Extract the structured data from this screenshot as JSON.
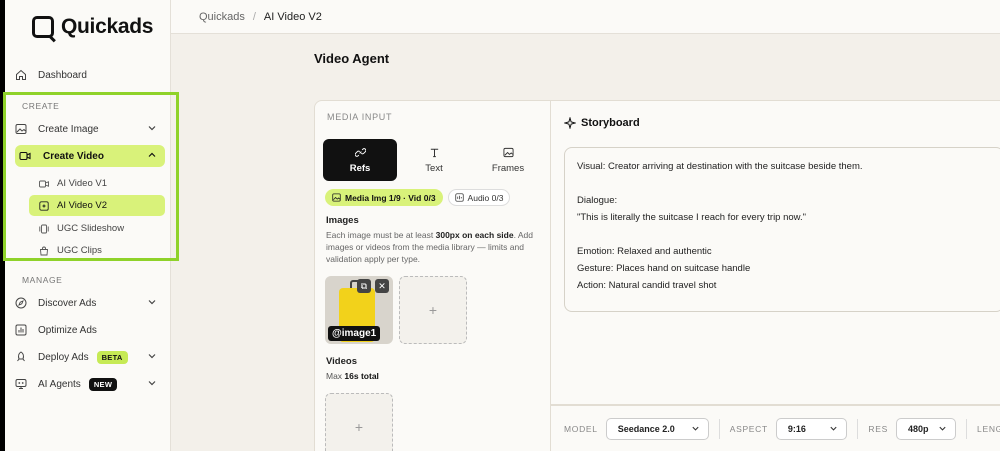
{
  "app": {
    "name": "Quickads"
  },
  "breadcrumb": {
    "root": "Quickads",
    "separator": "/",
    "current": "AI Video V2"
  },
  "sidebar": {
    "dashboard": "Dashboard",
    "create_section": "CREATE",
    "create_image": "Create Image",
    "create_video": "Create Video",
    "video_items": [
      "AI Video V1",
      "AI Video V2",
      "UGC Slideshow",
      "UGC Clips"
    ],
    "manage_section": "MANAGE",
    "discover_ads": "Discover Ads",
    "optimize_ads": "Optimize Ads",
    "deploy_ads": "Deploy Ads",
    "deploy_badge": "BETA",
    "ai_agents": "AI Agents",
    "agents_badge": "NEW"
  },
  "page": {
    "title": "Video Agent"
  },
  "media_input": {
    "label": "MEDIA INPUT",
    "tabs": [
      "Refs",
      "Text",
      "Frames"
    ],
    "active_tab": "Refs",
    "chips": {
      "media": "Media Img 1/9 · Vid 0/3",
      "audio": "Audio 0/3"
    },
    "images_heading": "Images",
    "help_pre": "Each image must be at least ",
    "help_bold": "300px on each side",
    "help_post": ". Add images or videos from the media library — limits and validation apply per type.",
    "image_tag": "@image1",
    "videos_heading": "Videos",
    "videos_max_pre": "Max ",
    "videos_max_bold": "16s total",
    "add_symbol": "+"
  },
  "storyboard": {
    "title": "Storyboard",
    "visual": "Visual: Creator arriving at destination with the suitcase beside them.",
    "dialogue_label": "Dialogue:",
    "dialogue": "\"This is literally the suitcase I reach for every trip now.\"",
    "emotion": "Emotion: Relaxed and authentic",
    "gesture": "Gesture: Places hand on suitcase handle",
    "action": "Action: Natural candid travel shot"
  },
  "controls": {
    "model_label": "MODEL",
    "model_value": "Seedance 2.0",
    "aspect_label": "ASPECT",
    "aspect_value": "9:16",
    "res_label": "RES",
    "res_value": "480p",
    "length_label": "LENG"
  },
  "colors": {
    "accent": "#d9f27a",
    "highlight_border": "#8fd22a"
  }
}
